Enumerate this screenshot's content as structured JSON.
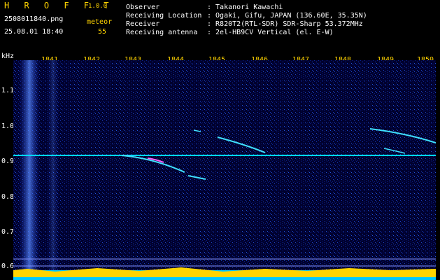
{
  "app": {
    "name": "H R O F F T",
    "version": "1.0.0"
  },
  "left_info": {
    "filename": "2508011840.png",
    "datetime": "25.08.01 18:40",
    "meteor_label": "meteor",
    "meteor_count": "55"
  },
  "info": [
    {
      "label": "Observer",
      "value": ": Takanori Kawachi"
    },
    {
      "label": "Receiving Location",
      "value": ": Ogaki, Gifu, JAPAN (136.60E, 35.35N)"
    },
    {
      "label": "Receiver",
      "value": ": R820T2(RTL-SDR) SDR-Sharp 53.372MHz"
    },
    {
      "label": "Receiving antenna",
      "value": ": 2el-HB9CV Vertical (el. E-W)"
    }
  ],
  "axis": {
    "unit": "kHz",
    "time_ticks": [
      "1841",
      "1842",
      "1843",
      "1844",
      "1845",
      "1846",
      "1847",
      "1848",
      "1849",
      "1850"
    ],
    "freq_ticks": [
      "1.1",
      "1.0",
      "0.9",
      "0.8",
      "0.7",
      "0.6"
    ]
  },
  "colors": {
    "accent": "#ffd400",
    "trace": "#00d0ff",
    "bg": "#000033"
  }
}
